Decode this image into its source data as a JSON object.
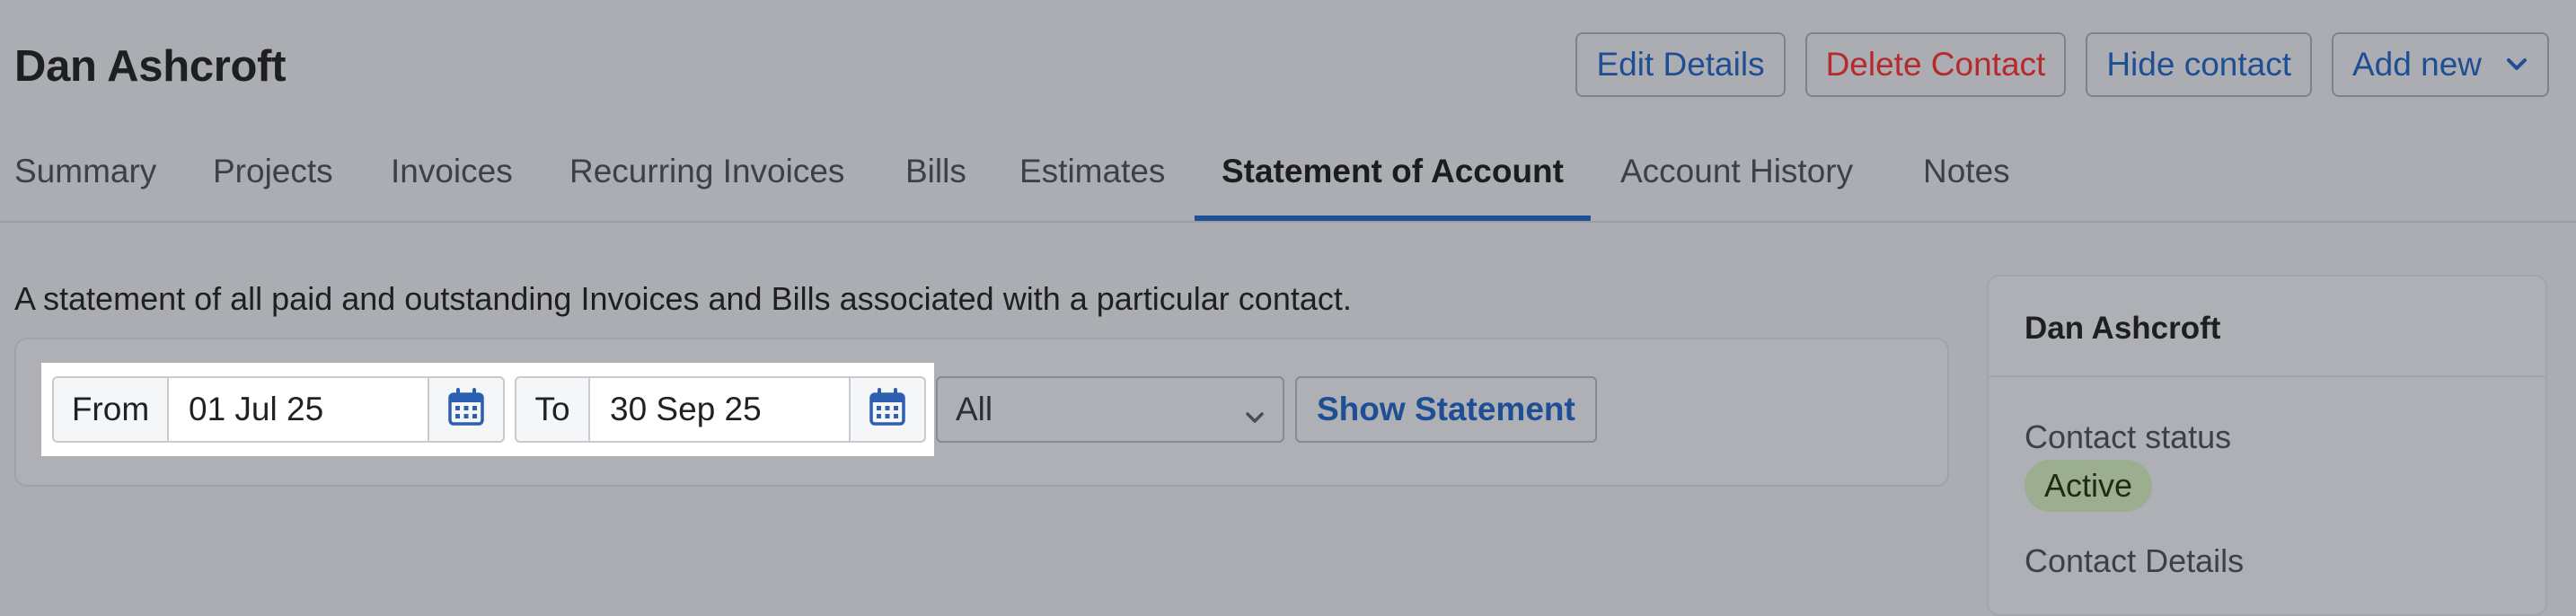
{
  "header": {
    "title": "Dan Ashcroft",
    "actions": {
      "edit": "Edit Details",
      "delete": "Delete Contact",
      "hide": "Hide contact",
      "add_new": "Add new"
    }
  },
  "tabs": [
    {
      "label": "Summary",
      "active": false
    },
    {
      "label": "Projects",
      "active": false
    },
    {
      "label": "Invoices",
      "active": false
    },
    {
      "label": "Recurring Invoices",
      "active": false
    },
    {
      "label": "Bills",
      "active": false
    },
    {
      "label": "Estimates",
      "active": false
    },
    {
      "label": "Statement of Account",
      "active": true
    },
    {
      "label": "Account History",
      "active": false
    },
    {
      "label": "Notes",
      "active": false
    }
  ],
  "statement": {
    "description": "A statement of all paid and outstanding Invoices and Bills associated with a particular contact.",
    "from_label": "From",
    "from_value": "01 Jul 25",
    "to_label": "To",
    "to_value": "30 Sep 25",
    "type_selected": "All",
    "show_button": "Show Statement"
  },
  "contact_card": {
    "name": "Dan Ashcroft",
    "status_label": "Contact status",
    "status_value": "Active",
    "details_label": "Contact Details"
  },
  "colors": {
    "accent": "#1f4f95",
    "danger": "#b52a2a",
    "active_badge": "#9bae8f"
  },
  "icons": {
    "calendar": "calendar-icon",
    "dropdown": "chevron-down-icon"
  }
}
